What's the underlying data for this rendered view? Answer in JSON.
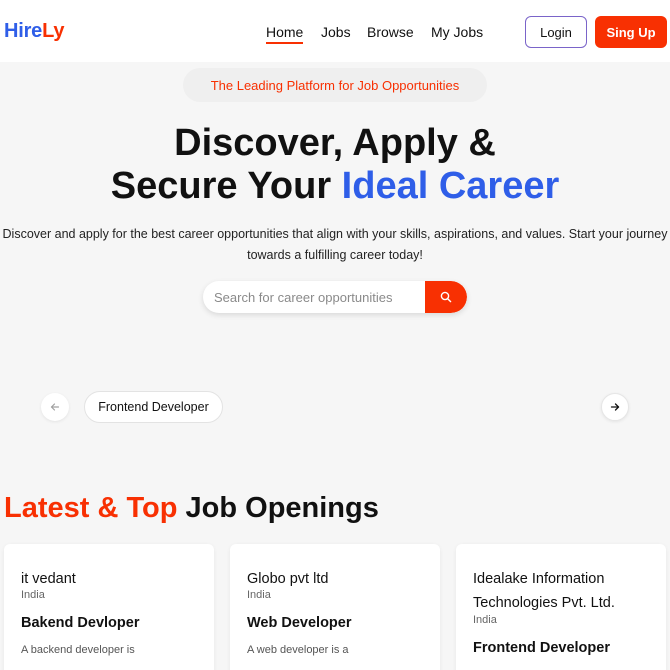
{
  "brand": {
    "part1": "Hire",
    "part2": "Ly"
  },
  "nav": {
    "home": "Home",
    "jobs": "Jobs",
    "browse": "Browse",
    "my_jobs": "My Jobs"
  },
  "auth": {
    "login": "Login",
    "signup": "Sing Up"
  },
  "hero": {
    "badge": "The Leading Platform for Job Opportunities",
    "title_line1": "Discover, Apply &",
    "title_line2_prefix": "Secure Your ",
    "title_line2_accent": "Ideal Career",
    "description": "Discover and apply for the best career opportunities that align with your skills, aspirations, and values. Start your journey towards a fulfilling career today!"
  },
  "search": {
    "placeholder": "Search for career opportunities",
    "value": ""
  },
  "carousel": {
    "items": [
      "Frontend Developer"
    ]
  },
  "latest": {
    "title_accent": "Latest & Top",
    "title_rest": " Job Openings"
  },
  "jobs": [
    {
      "company": "it vedant",
      "location": "India",
      "role": "Bakend Devloper",
      "desc": "A backend developer is"
    },
    {
      "company": "Globo pvt ltd",
      "location": "India",
      "role": "Web Developer",
      "desc": "A web developer is a"
    },
    {
      "company": "Idealake Information Technologies Pvt. Ltd.",
      "location": "India",
      "role": "Frontend Developer",
      "desc": ""
    }
  ],
  "colors": {
    "primary_red": "#f83002",
    "accent_blue": "#2f5ee8",
    "login_border": "#7a64c9"
  },
  "icons": {
    "search": "search-icon",
    "prev": "arrow-left-icon",
    "next": "arrow-right-icon"
  }
}
